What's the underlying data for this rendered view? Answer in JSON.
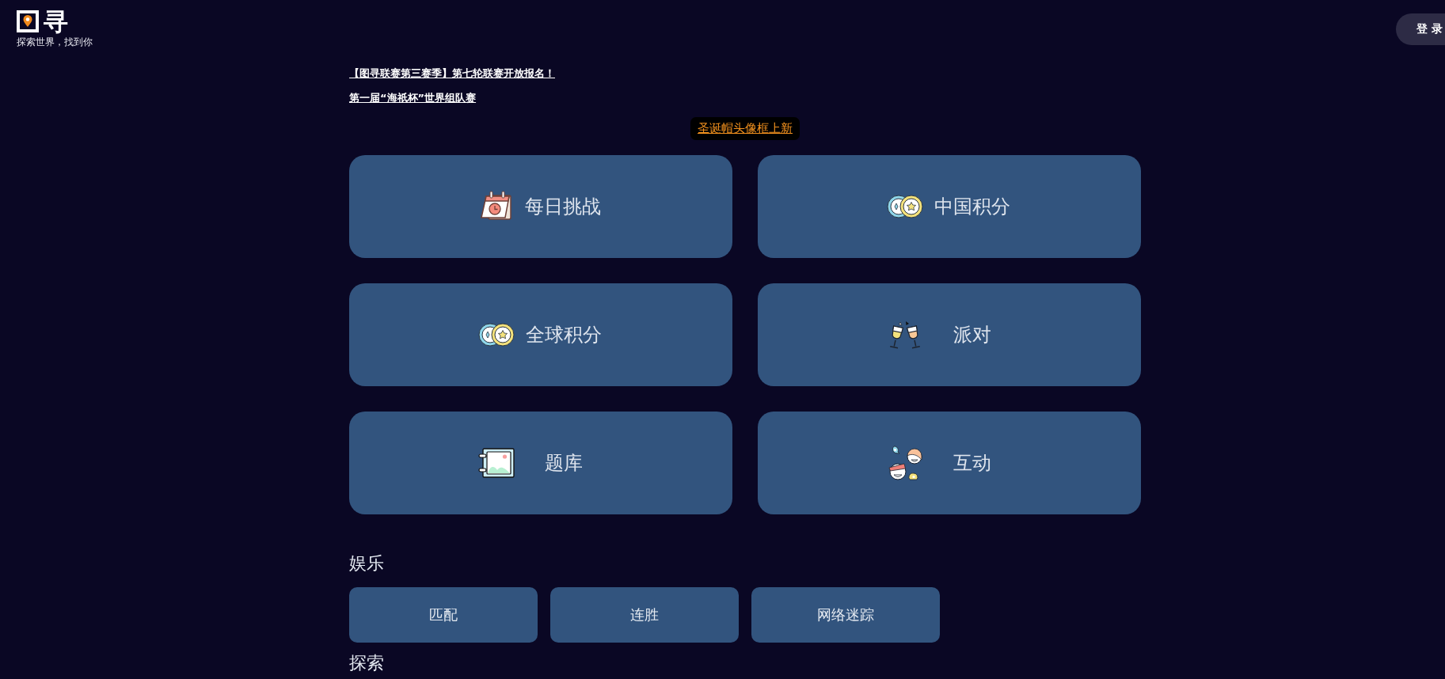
{
  "header": {
    "logo": {
      "text": "寻",
      "tagline": "探索世界，找到你"
    },
    "login_button": "登 录"
  },
  "announcements": [
    {
      "text": "【图寻联赛第三赛季】第七轮联赛开放报名！"
    },
    {
      "text": "第一届“海祇杯”世界组队赛"
    }
  ],
  "banner": {
    "text": "圣诞帽头像框上新"
  },
  "modes": [
    {
      "label": "每日挑战"
    },
    {
      "label": "中国积分"
    },
    {
      "label": "全球积分"
    },
    {
      "label": "派对"
    },
    {
      "label": "题库"
    },
    {
      "label": "互动"
    }
  ],
  "sections": [
    {
      "title": "娱乐",
      "items": [
        {
          "label": "匹配"
        },
        {
          "label": "连胜"
        },
        {
          "label": "网络迷踪"
        }
      ]
    },
    {
      "title": "探索"
    }
  ]
}
